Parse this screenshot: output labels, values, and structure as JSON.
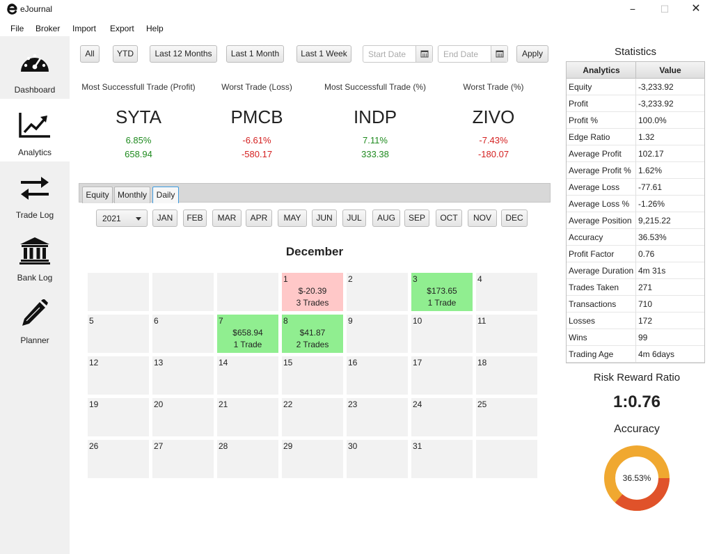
{
  "app": {
    "title": "eJournal"
  },
  "window": {
    "minimize": "−",
    "maximize": "☐",
    "close": "✕"
  },
  "menu": [
    "File",
    "Broker",
    "Import",
    "Export",
    "Help"
  ],
  "sidebar": [
    {
      "label": "Dashboard",
      "icon": "dashboard-icon"
    },
    {
      "label": "Analytics",
      "icon": "analytics-icon"
    },
    {
      "label": "Trade Log",
      "icon": "trade-log-icon"
    },
    {
      "label": "Bank Log",
      "icon": "bank-icon"
    },
    {
      "label": "Planner",
      "icon": "pencil-icon"
    }
  ],
  "toolbar": {
    "buttons": [
      "All",
      "YTD",
      "Last 12 Months",
      "Last 1 Month",
      "Last 1 Week"
    ],
    "start_placeholder": "Start Date",
    "end_placeholder": "End Date",
    "apply": "Apply"
  },
  "highlights": [
    {
      "caption": "Most Successfull Trade (Profit)",
      "symbol": "SYTA",
      "percent": "6.85%",
      "value": "658.94",
      "tone": "green"
    },
    {
      "caption": "Worst Trade (Loss)",
      "symbol": "PMCB",
      "percent": "-6.61%",
      "value": "-580.17",
      "tone": "red"
    },
    {
      "caption": "Most Successfull Trade (%)",
      "symbol": "INDP",
      "percent": "7.11%",
      "value": "333.38",
      "tone": "green"
    },
    {
      "caption": "Worst Trade (%)",
      "symbol": "ZIVO",
      "percent": "-7.43%",
      "value": "-180.07",
      "tone": "red"
    }
  ],
  "tabs": [
    "Equity",
    "Monthly",
    "Daily"
  ],
  "active_tab": "Daily",
  "year": "2021",
  "months": [
    "JAN",
    "FEB",
    "MAR",
    "APR",
    "MAY",
    "JUN",
    "JUL",
    "AUG",
    "SEP",
    "OCT",
    "NOV",
    "DEC"
  ],
  "calendar": {
    "month_title": "December",
    "leading_blanks": 3,
    "days": 31,
    "entries": [
      {
        "day": 1,
        "amount": "$-20.39",
        "trades": "3 Trades",
        "status": "loss"
      },
      {
        "day": 3,
        "amount": "$173.65",
        "trades": "1 Trade",
        "status": "profit"
      },
      {
        "day": 7,
        "amount": "$658.94",
        "trades": "1 Trade",
        "status": "profit"
      },
      {
        "day": 8,
        "amount": "$41.87",
        "trades": "2 Trades",
        "status": "profit"
      }
    ]
  },
  "statistics": {
    "title": "Statistics",
    "headers": [
      "Analytics",
      "Value"
    ],
    "rows": [
      [
        "Equity",
        "-3,233.92"
      ],
      [
        "Profit",
        "-3,233.92"
      ],
      [
        "Profit %",
        "100.0%"
      ],
      [
        "Edge Ratio",
        "1.32"
      ],
      [
        "Average Profit",
        "102.17"
      ],
      [
        "Average Profit %",
        "1.62%"
      ],
      [
        "Average Loss",
        "-77.61"
      ],
      [
        "Average Loss %",
        "-1.26%"
      ],
      [
        "Average Position",
        "9,215.22"
      ],
      [
        "Accuracy",
        "36.53%"
      ],
      [
        "Profit Factor",
        "0.76"
      ],
      [
        "Average Duration",
        "4m 31s"
      ],
      [
        "Trades Taken",
        "271"
      ],
      [
        "Transactions",
        "710"
      ],
      [
        "Losses",
        "172"
      ],
      [
        "Wins",
        "99"
      ],
      [
        "Trading Age",
        "4m 6days"
      ]
    ]
  },
  "risk_reward": {
    "title": "Risk Reward Ratio",
    "value": "1:0.76"
  },
  "accuracy": {
    "title": "Accuracy",
    "label": "36.53%",
    "fraction": 0.3653
  },
  "colors": {
    "profit": "#90ee90",
    "loss": "#ffc8c8",
    "donut_win": "#e0522a",
    "donut_rest": "#f0a830"
  }
}
